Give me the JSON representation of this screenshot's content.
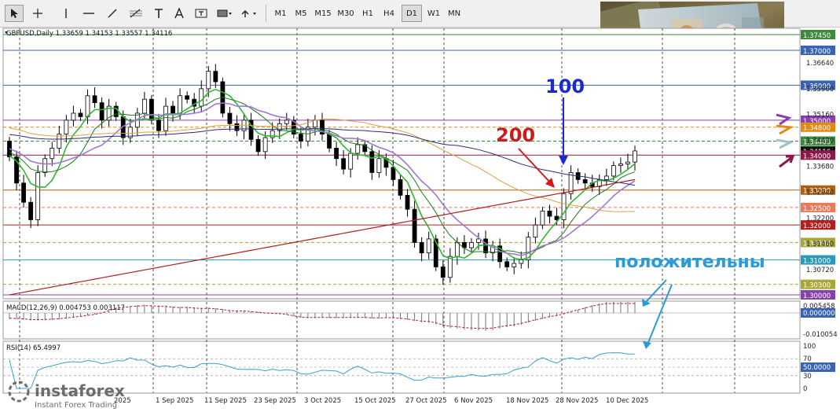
{
  "toolbar": {
    "timeframes": [
      "M1",
      "M5",
      "M15",
      "M30",
      "H1",
      "H4",
      "D1",
      "W1",
      "MN"
    ],
    "active_timeframe": "D1",
    "tools": [
      "cursor-icon",
      "crosshair-icon",
      "vertical-line-icon",
      "horizontal-line-icon",
      "trendline-icon",
      "fibonacci-icon",
      "text-tool-icon",
      "label-tool-icon",
      "shapes-icon",
      "arrows-icon"
    ]
  },
  "chart_data": {
    "type": "candlestick",
    "symbol_header": "GBPUSD,Daily  1.33659 1.34153 1.33557 1.34116",
    "price_axis": [
      "1.36640",
      "1.35900",
      "1.35160",
      "1.34420",
      "1.33680",
      "1.32940",
      "1.32200",
      "1.31460",
      "1.30720"
    ],
    "level_labels": [
      {
        "label": "1.37450",
        "value": 1.3745,
        "color": "#3c8a3c"
      },
      {
        "label": "1.37000",
        "value": 1.37,
        "color": "#3a63b6"
      },
      {
        "label": "1.36000",
        "value": 1.36,
        "color": "#3a63b6"
      },
      {
        "label": "1.35000",
        "value": 1.35,
        "color": "#8a3fb0"
      },
      {
        "label": "1.34800",
        "value": 1.348,
        "color": "#e08a12"
      },
      {
        "label": "1.34400",
        "value": 1.344,
        "color": "#3c8a3c"
      },
      {
        "label": "1.34116",
        "value": 1.34116,
        "color": "#111111"
      },
      {
        "label": "1.34000",
        "value": 1.34,
        "color": "#8b1a4a"
      },
      {
        "label": "1.33000",
        "value": 1.33,
        "color": "#b06010"
      },
      {
        "label": "1.32500",
        "value": 1.325,
        "color": "#e87a5a"
      },
      {
        "label": "1.32000",
        "value": 1.32,
        "color": "#b02020"
      },
      {
        "label": "1.31500",
        "value": 1.315,
        "color": "#a8a838"
      },
      {
        "label": "1.31000",
        "value": 1.31,
        "color": "#2a9ab8"
      },
      {
        "label": "1.30300",
        "value": 1.303,
        "color": "#a8a838"
      },
      {
        "label": "1.30000",
        "value": 1.3,
        "color": "#8a3fb0"
      }
    ],
    "date_axis": [
      "1 Sep 2025",
      "11 Sep 2025",
      "23 Sep 2025",
      "3 Oct 2025",
      "15 Oct 2025",
      "27 Oct 2025",
      "6 Nov 2025",
      "18 Nov 2025",
      "28 Nov 2025",
      "10 Dec 2025"
    ],
    "date_axis_left_partial": "2025",
    "annotations": {
      "ma100": {
        "text": "100",
        "color": "#1a2ad0"
      },
      "ma200": {
        "text": "200",
        "color": "#d01a1a"
      },
      "positive": {
        "text": "положительны",
        "color": "#2a9ad8"
      }
    },
    "macd": {
      "header": "MACD(12,26,9) 0.004753 0.003117",
      "axis": [
        "0.005458",
        "0.000000",
        "-0.010054"
      ]
    },
    "rsi": {
      "header": "RSI(14) 65.4997",
      "axis": [
        "100",
        "70",
        "50.0000",
        "30",
        "0"
      ]
    },
    "closes": [
      1.3395,
      1.332,
      1.3265,
      1.3215,
      1.335,
      1.339,
      1.342,
      1.346,
      1.35,
      1.352,
      1.351,
      1.357,
      1.355,
      1.35,
      1.354,
      1.351,
      1.345,
      1.348,
      1.352,
      1.356,
      1.35,
      1.347,
      1.354,
      1.352,
      1.357,
      1.356,
      1.354,
      1.359,
      1.364,
      1.361,
      1.352,
      1.349,
      1.347,
      1.35,
      1.3445,
      1.341,
      1.345,
      1.347,
      1.349,
      1.35,
      1.346,
      1.344,
      1.348,
      1.35,
      1.346,
      1.342,
      1.339,
      1.336,
      1.3405,
      1.343,
      1.341,
      1.335,
      1.339,
      1.3365,
      1.333,
      1.3285,
      1.3245,
      1.315,
      1.312,
      1.316,
      1.308,
      1.305,
      1.311,
      1.315,
      1.3135,
      1.315,
      1.316,
      1.312,
      1.314,
      1.3095,
      1.308,
      1.309,
      1.31,
      1.3165,
      1.32,
      1.324,
      1.3225,
      1.3215,
      1.329,
      1.335,
      1.333,
      1.332,
      1.331,
      1.333,
      1.334,
      1.337,
      1.3375,
      1.338,
      1.3412
    ]
  }
}
